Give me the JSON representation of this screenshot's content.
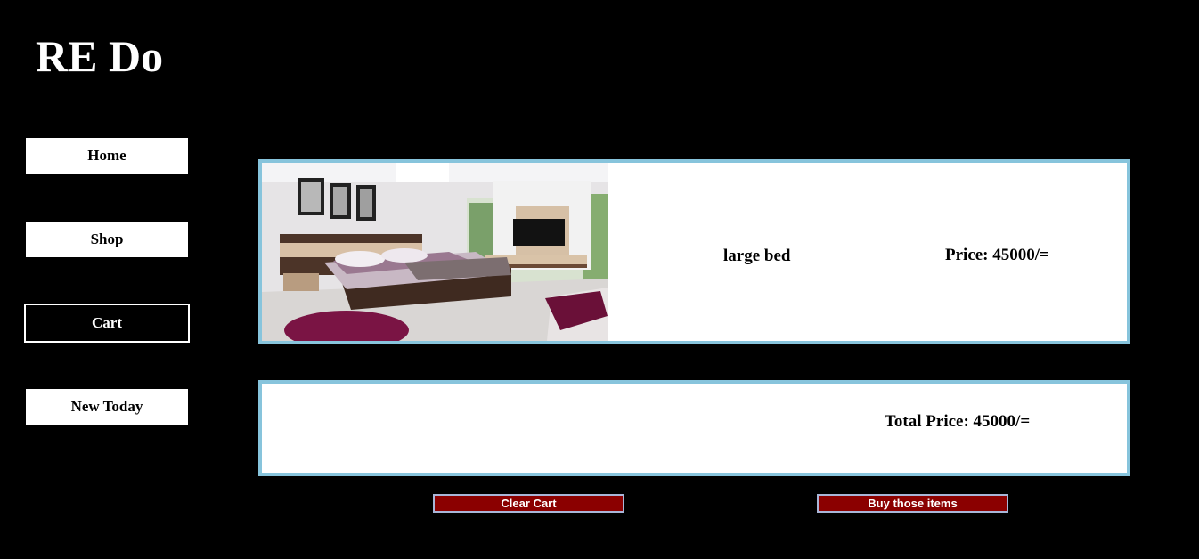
{
  "brand": {
    "title": "RE Do"
  },
  "nav": {
    "items": [
      {
        "label": "Home",
        "active": false
      },
      {
        "label": "Shop",
        "active": false
      },
      {
        "label": "Cart",
        "active": true
      },
      {
        "label": "New Today",
        "active": false
      }
    ]
  },
  "cart": {
    "items": [
      {
        "image": "bedroom-photo",
        "name": "large bed",
        "price_text": "Price: 45000/="
      }
    ],
    "total_text": "Total Price: 45000/="
  },
  "actions": {
    "clear_label": "Clear Cart",
    "buy_label": "Buy those items"
  },
  "colors": {
    "background": "#000000",
    "panel_border": "#87c4dc",
    "action_button": "#8b0000",
    "action_button_border": "#a9b6d8"
  }
}
